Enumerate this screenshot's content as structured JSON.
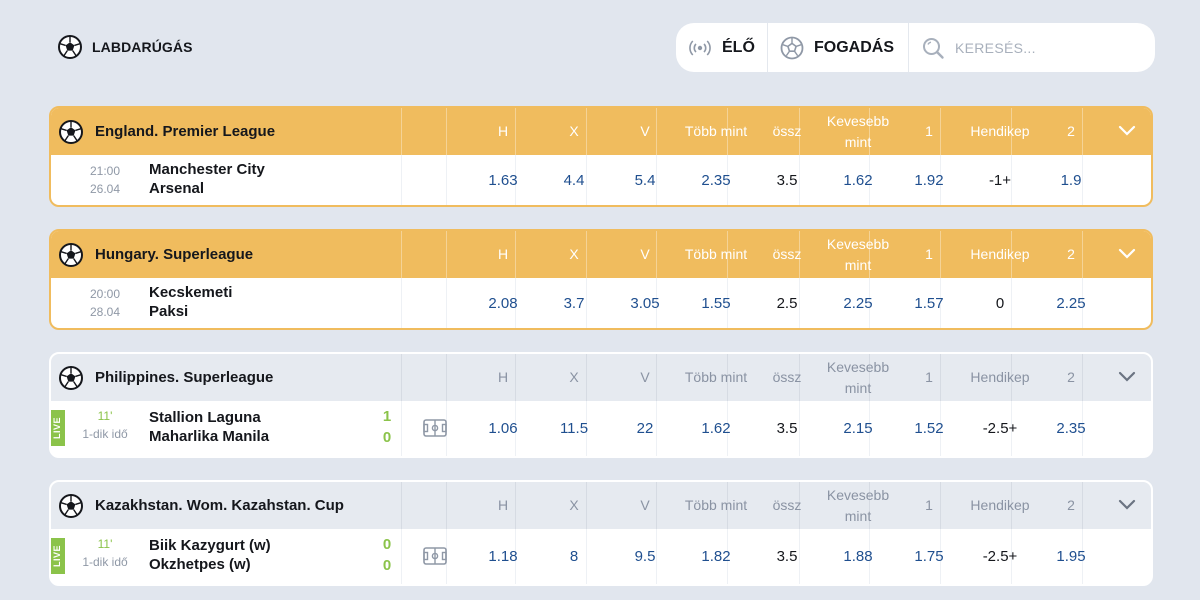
{
  "header": {
    "sport_label": "LABDARÚGÁS",
    "live_label": "ÉLŐ",
    "bet_label": "FOGADÁS",
    "search_placeholder": "KERESÉS..."
  },
  "columns": [
    "H",
    "X",
    "V",
    "Több mint",
    "össz",
    "Kevesebb mint",
    "1",
    "Hendikep",
    "2"
  ],
  "leagues": [
    {
      "name": "England. Premier League",
      "state": "prematch",
      "col_labels": {
        "c0": "H",
        "c1": "X",
        "c2": "V",
        "c3": "Több mint",
        "c4": "össz",
        "c5": "Kevesebb mint",
        "c6": "1",
        "c7": "Hendikep",
        "c8": "2"
      },
      "match": {
        "time": "21:00",
        "date": "26.04",
        "home": "Manchester City",
        "away": "Arsenal",
        "odds": {
          "h": "1.63",
          "x": "4.4",
          "v": "5.4",
          "over": "2.35",
          "total": "3.5",
          "under": "1.62",
          "hcp1": "1.92",
          "hcp": "-1+",
          "hcp2": "1.9"
        }
      }
    },
    {
      "name": "Hungary. Superleague",
      "state": "prematch",
      "col_labels": {
        "c0": "H",
        "c1": "X",
        "c2": "V",
        "c3": "Több mint",
        "c4": "össz",
        "c5": "Kevesebb mint",
        "c6": "1",
        "c7": "Hendikep",
        "c8": "2"
      },
      "match": {
        "time": "20:00",
        "date": "28.04",
        "home": "Kecskemeti",
        "away": "Paksi",
        "odds": {
          "h": "2.08",
          "x": "3.7",
          "v": "3.05",
          "over": "1.55",
          "total": "2.5",
          "under": "2.25",
          "hcp1": "1.57",
          "hcp": "0",
          "hcp2": "2.25"
        }
      }
    },
    {
      "name": "Philippines. Superleague",
      "state": "live",
      "col_labels": {
        "c0": "H",
        "c1": "X",
        "c2": "V",
        "c3": "Több mint",
        "c4": "össz",
        "c5": "Kevesebb mint",
        "c6": "1",
        "c7": "Hendikep",
        "c8": "2"
      },
      "match": {
        "live_badge": "LIVE",
        "minute": "11'",
        "period": "1-dik idő",
        "home": "Stallion Laguna",
        "away": "Maharlika Manila",
        "home_score": "1",
        "away_score": "0",
        "odds": {
          "h": "1.06",
          "x": "11.5",
          "v": "22",
          "over": "1.62",
          "total": "3.5",
          "under": "2.15",
          "hcp1": "1.52",
          "hcp": "-2.5+",
          "hcp2": "2.35"
        }
      }
    },
    {
      "name": "Kazakhstan. Wom. Kazahstan. Cup",
      "state": "live",
      "col_labels": {
        "c0": "H",
        "c1": "X",
        "c2": "V",
        "c3": "Több mint",
        "c4": "össz",
        "c5": "Kevesebb mint",
        "c6": "1",
        "c7": "Hendikep",
        "c8": "2"
      },
      "match": {
        "live_badge": "LIVE",
        "minute": "11'",
        "period": "1-dik idő",
        "home": "Biik Kazygurt (w)",
        "away": "Okzhetpes (w)",
        "home_score": "0",
        "away_score": "0",
        "odds": {
          "h": "1.18",
          "x": "8",
          "v": "9.5",
          "over": "1.82",
          "total": "3.5",
          "under": "1.88",
          "hcp1": "1.75",
          "hcp": "-2.5+",
          "hcp2": "1.95"
        }
      }
    }
  ],
  "colors": {
    "prematch_header": "#f0bc5e",
    "live_header": "#e6eaf0",
    "odds_text": "#1f4f8f",
    "live_green": "#8bc34a",
    "page_bg": "#e1e6ee"
  },
  "icons": {
    "sport": "soccer-ball-icon",
    "live": "broadcast-icon",
    "bet": "soccer-ball-icon",
    "search": "magnifier-icon",
    "expand": "chevron-down-icon",
    "field": "football-field-icon"
  }
}
